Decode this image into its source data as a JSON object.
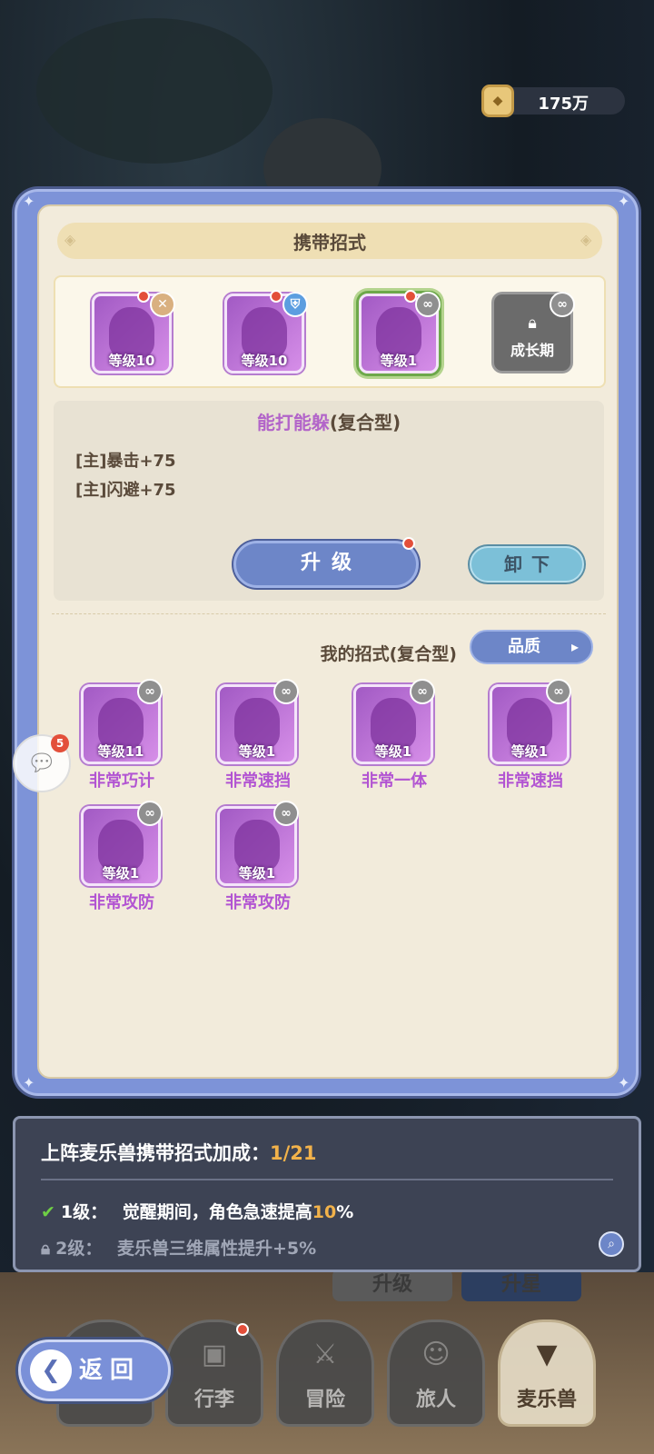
{
  "currency": {
    "amount": "175万"
  },
  "panel": {
    "title": "携带招式"
  },
  "carried": [
    {
      "level": "等级10",
      "badge": "x-icon"
    },
    {
      "level": "等级10",
      "badge": "shield-icon"
    },
    {
      "level": "等级1",
      "badge": "link-icon"
    },
    {
      "locked_label": "成长期"
    }
  ],
  "detail": {
    "name": "能打能躲",
    "type": "(复合型)",
    "stats": [
      "[主]暴击+75",
      "[主]闪避+75"
    ],
    "upgrade_label": "升级",
    "unequip_label": "卸下"
  },
  "my_skills": {
    "title": "我的招式(复合型)",
    "filter_label": "品质",
    "items": [
      {
        "level": "等级11",
        "name": "非常巧计"
      },
      {
        "level": "等级1",
        "name": "非常速挡"
      },
      {
        "level": "等级1",
        "name": "非常一体"
      },
      {
        "level": "等级1",
        "name": "非常速挡"
      },
      {
        "level": "等级1",
        "name": "非常攻防"
      },
      {
        "level": "等级1",
        "name": "非常攻防"
      }
    ]
  },
  "chat": {
    "count": "5"
  },
  "bonus": {
    "title": "上阵麦乐兽携带招式加成：",
    "progress": "1/21",
    "lines": [
      {
        "level": "1级：",
        "text_before": "觉醒期间，角色急速提高",
        "highlight": "10",
        "text_after": "%",
        "unlocked": true
      },
      {
        "level": "2级：",
        "text": "麦乐兽三维属性提升+5%",
        "unlocked": false
      }
    ]
  },
  "hidden_tabs": [
    "升级",
    "升星"
  ],
  "nav": {
    "back_label": "返回",
    "items": [
      "行李",
      "冒险",
      "旅人",
      "麦乐兽"
    ]
  },
  "colors": {
    "accent": "#6d86c8",
    "skill_purple": "#b254d2",
    "gold": "#f2b24a"
  }
}
